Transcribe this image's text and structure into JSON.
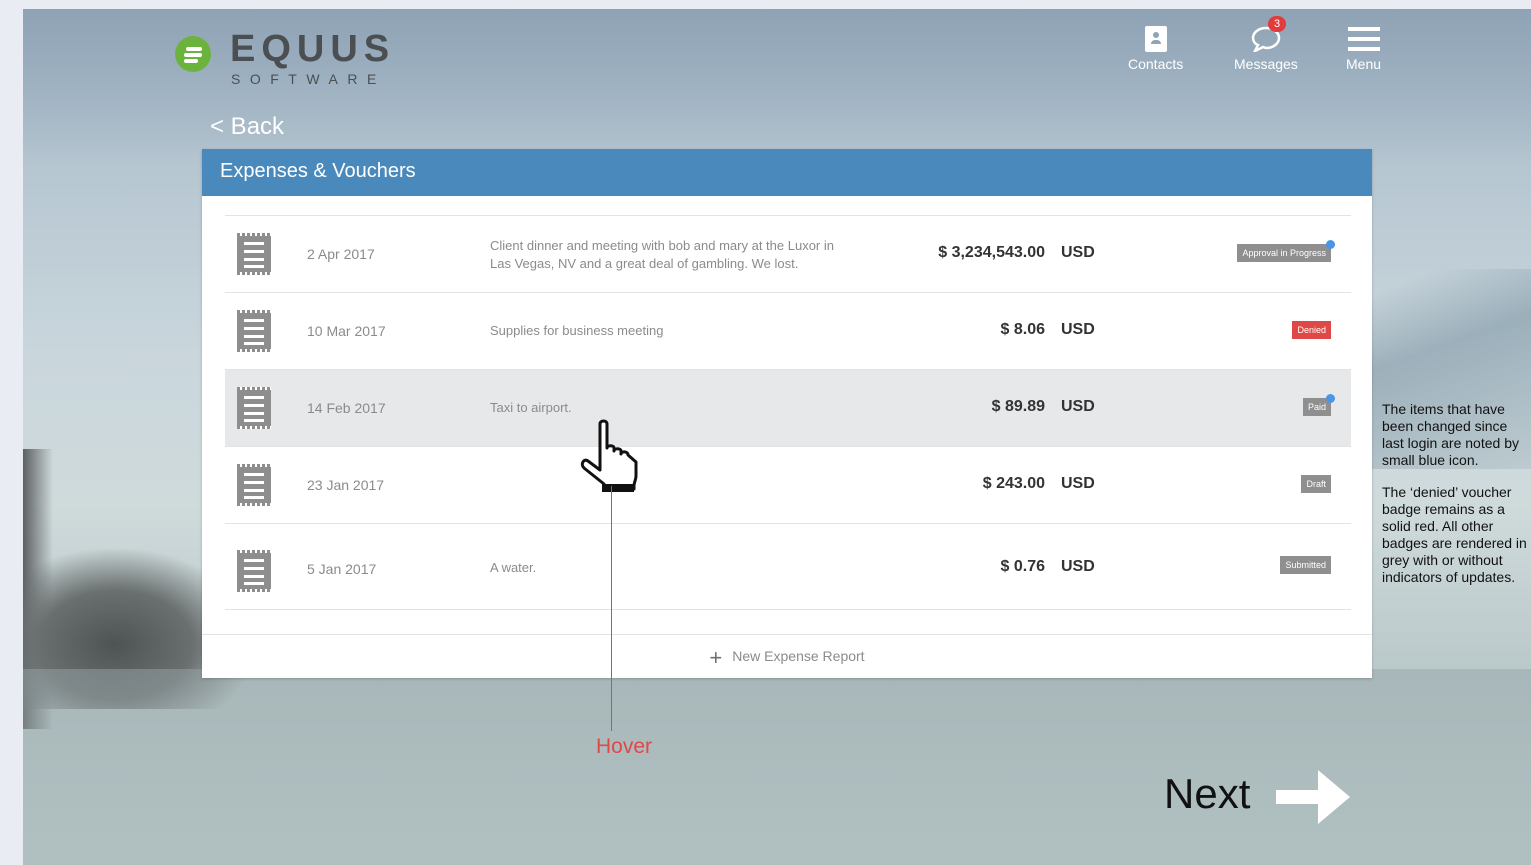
{
  "brand": {
    "name": "EQUUS",
    "sub": "SOFTWARE",
    "color": "#6cb33e"
  },
  "nav": {
    "contacts": {
      "label": "Contacts",
      "icon": "contact-card-icon"
    },
    "messages": {
      "label": "Messages",
      "icon": "chat-bubble-icon",
      "count": "3"
    },
    "menu": {
      "label": "Menu",
      "icon": "hamburger-icon"
    }
  },
  "back_label": "< Back",
  "panel": {
    "title": "Expenses & Vouchers",
    "accent": "#4a89bb",
    "rows": [
      {
        "date": "2 Apr 2017",
        "description": "Client dinner and meeting with bob and mary at the Luxor in Las Vegas, NV and a great deal of gambling. We lost.",
        "amount": "$ 3,234,543.00",
        "currency": "USD",
        "status": "Approval in Progress",
        "updated": true
      },
      {
        "date": "10 Mar 2017",
        "description": "Supplies for business meeting",
        "amount": "$ 8.06",
        "currency": "USD",
        "status": "Denied",
        "updated": false
      },
      {
        "date": "14 Feb 2017",
        "description": "Taxi to airport.",
        "amount": "$ 89.89",
        "currency": "USD",
        "status": "Paid",
        "updated": true
      },
      {
        "date": "23 Jan 2017",
        "description": "",
        "amount": "$ 243.00",
        "currency": "USD",
        "status": "Draft",
        "updated": false
      },
      {
        "date": "5 Jan 2017",
        "description": "A water.",
        "amount": "$ 0.76",
        "currency": "USD",
        "status": "Submitted",
        "updated": false
      }
    ],
    "new_report_label": "New Expense Report"
  },
  "annotations": {
    "hover_label": "Hover",
    "note1": "The items that have been changed since last login are noted by small blue icon.",
    "note2": "The ‘denied’ voucher badge remains as a solid red. All other badges are rendered in grey with or without indicators of updates.",
    "next_label": "Next"
  }
}
